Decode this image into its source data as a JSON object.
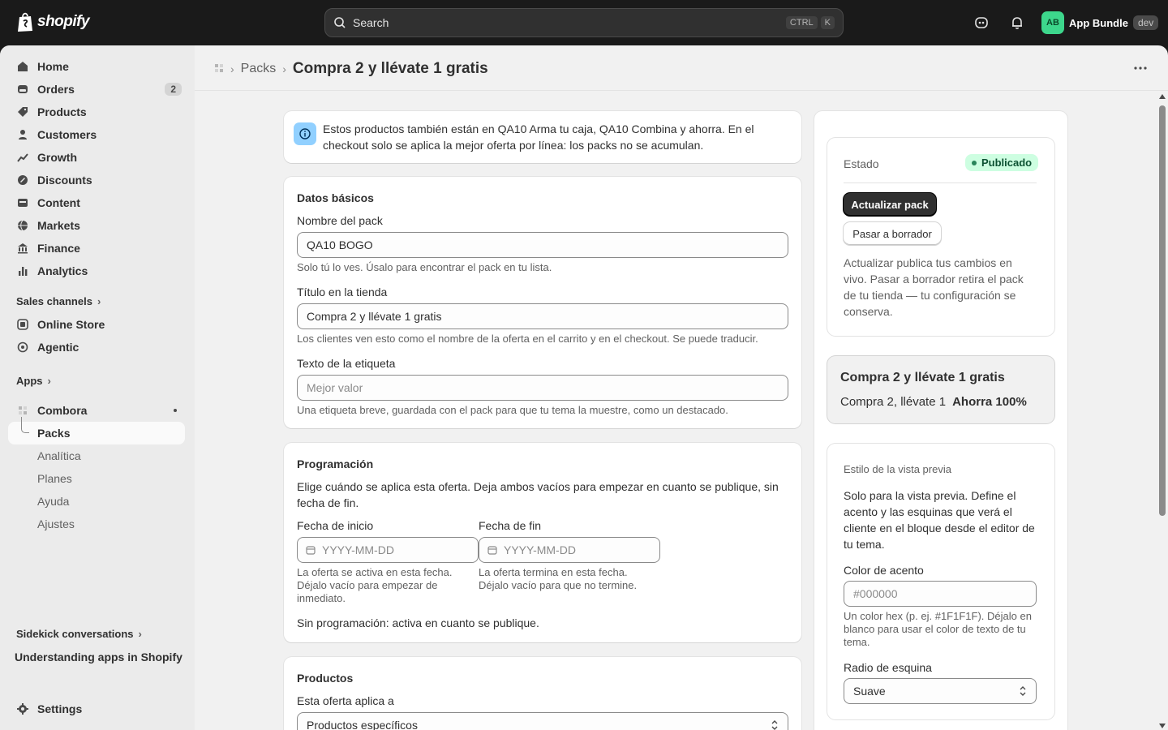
{
  "topbar": {
    "logo_text": "shopify",
    "search_placeholder": "Search",
    "shortcut_ctrl": "CTRL",
    "shortcut_k": "K",
    "avatar_initials": "AB",
    "store_name": "App Bundle",
    "store_badge": "dev"
  },
  "sidebar": {
    "items": [
      {
        "label": "Home",
        "icon": "home-icon"
      },
      {
        "label": "Orders",
        "icon": "orders-icon",
        "badge": "2"
      },
      {
        "label": "Products",
        "icon": "tag-icon"
      },
      {
        "label": "Customers",
        "icon": "person-icon"
      },
      {
        "label": "Growth",
        "icon": "growth-icon"
      },
      {
        "label": "Discounts",
        "icon": "discount-icon"
      },
      {
        "label": "Content",
        "icon": "content-icon"
      },
      {
        "label": "Markets",
        "icon": "globe-icon"
      },
      {
        "label": "Finance",
        "icon": "bank-icon"
      },
      {
        "label": "Analytics",
        "icon": "chart-icon"
      }
    ],
    "sales_channels_label": "Sales channels",
    "channels": [
      {
        "label": "Online Store",
        "icon": "store-icon"
      },
      {
        "label": "Agentic",
        "icon": "agentic-icon"
      }
    ],
    "apps_label": "Apps",
    "app_name": "Combora",
    "app_sub": [
      "Packs",
      "Analítica",
      "Planes",
      "Ayuda",
      "Ajustes"
    ],
    "sidekick_label": "Sidekick conversations",
    "sidekick_item": "Understanding apps in Shopify",
    "settings_label": "Settings"
  },
  "page": {
    "breadcrumb": "Packs",
    "title": "Compra 2 y llévate 1 gratis"
  },
  "banner": {
    "text": "Estos productos también están en QA10 Arma tu caja, QA10 Combina y ahorra. En el checkout solo se aplica la mejor oferta por línea: los packs no se acumulan."
  },
  "basic": {
    "heading": "Datos básicos",
    "name_label": "Nombre del pack",
    "name_value": "QA10 BOGO",
    "name_help": "Solo tú lo ves. Úsalo para encontrar el pack en tu lista.",
    "title_label": "Título en la tienda",
    "title_value": "Compra 2 y llévate 1 gratis",
    "title_help": "Los clientes ven esto como el nombre de la oferta en el carrito y en el checkout. Se puede traducir.",
    "tag_label": "Texto de la etiqueta",
    "tag_placeholder": "Mejor valor",
    "tag_help": "Una etiqueta breve, guardada con el pack para que tu tema la muestre, como un destacado."
  },
  "schedule": {
    "heading": "Programación",
    "desc": "Elige cuándo se aplica esta oferta. Deja ambos vacíos para empezar en cuanto se publique, sin fecha de fin.",
    "start_label": "Fecha de inicio",
    "start_placeholder": "YYYY-MM-DD",
    "start_help": "La oferta se activa en esta fecha. Déjalo vacío para empezar de inmediato.",
    "end_label": "Fecha de fin",
    "end_placeholder": "YYYY-MM-DD",
    "end_help": "La oferta termina en esta fecha. Déjalo vacío para que no termine.",
    "status": "Sin programación: activa en cuanto se publique."
  },
  "products": {
    "heading": "Productos",
    "applies_label": "Esta oferta aplica a",
    "applies_value": "Productos específicos"
  },
  "status_card": {
    "label": "Estado",
    "badge": "Publicado",
    "update_button": "Actualizar pack",
    "draft_button": "Pasar a borrador",
    "help": "Actualizar publica tus cambios en vivo. Pasar a borrador retira el pack de tu tienda — tu configuración se conserva."
  },
  "preview": {
    "title": "Compra 2 y llévate 1 gratis",
    "subtitle": "Compra 2, llévate 1",
    "savings": "Ahorra 100%"
  },
  "style_card": {
    "heading": "Estilo de la vista previa",
    "desc": "Solo para la vista previa. Define el acento y las esquinas que verá el cliente en el bloque desde el editor de tu tema.",
    "accent_label": "Color de acento",
    "accent_placeholder": "#000000",
    "accent_help": "Un color hex (p. ej. #1F1F1F). Déjalo en blanco para usar el color de texto de tu tema.",
    "radius_label": "Radio de esquina",
    "radius_value": "Suave"
  }
}
